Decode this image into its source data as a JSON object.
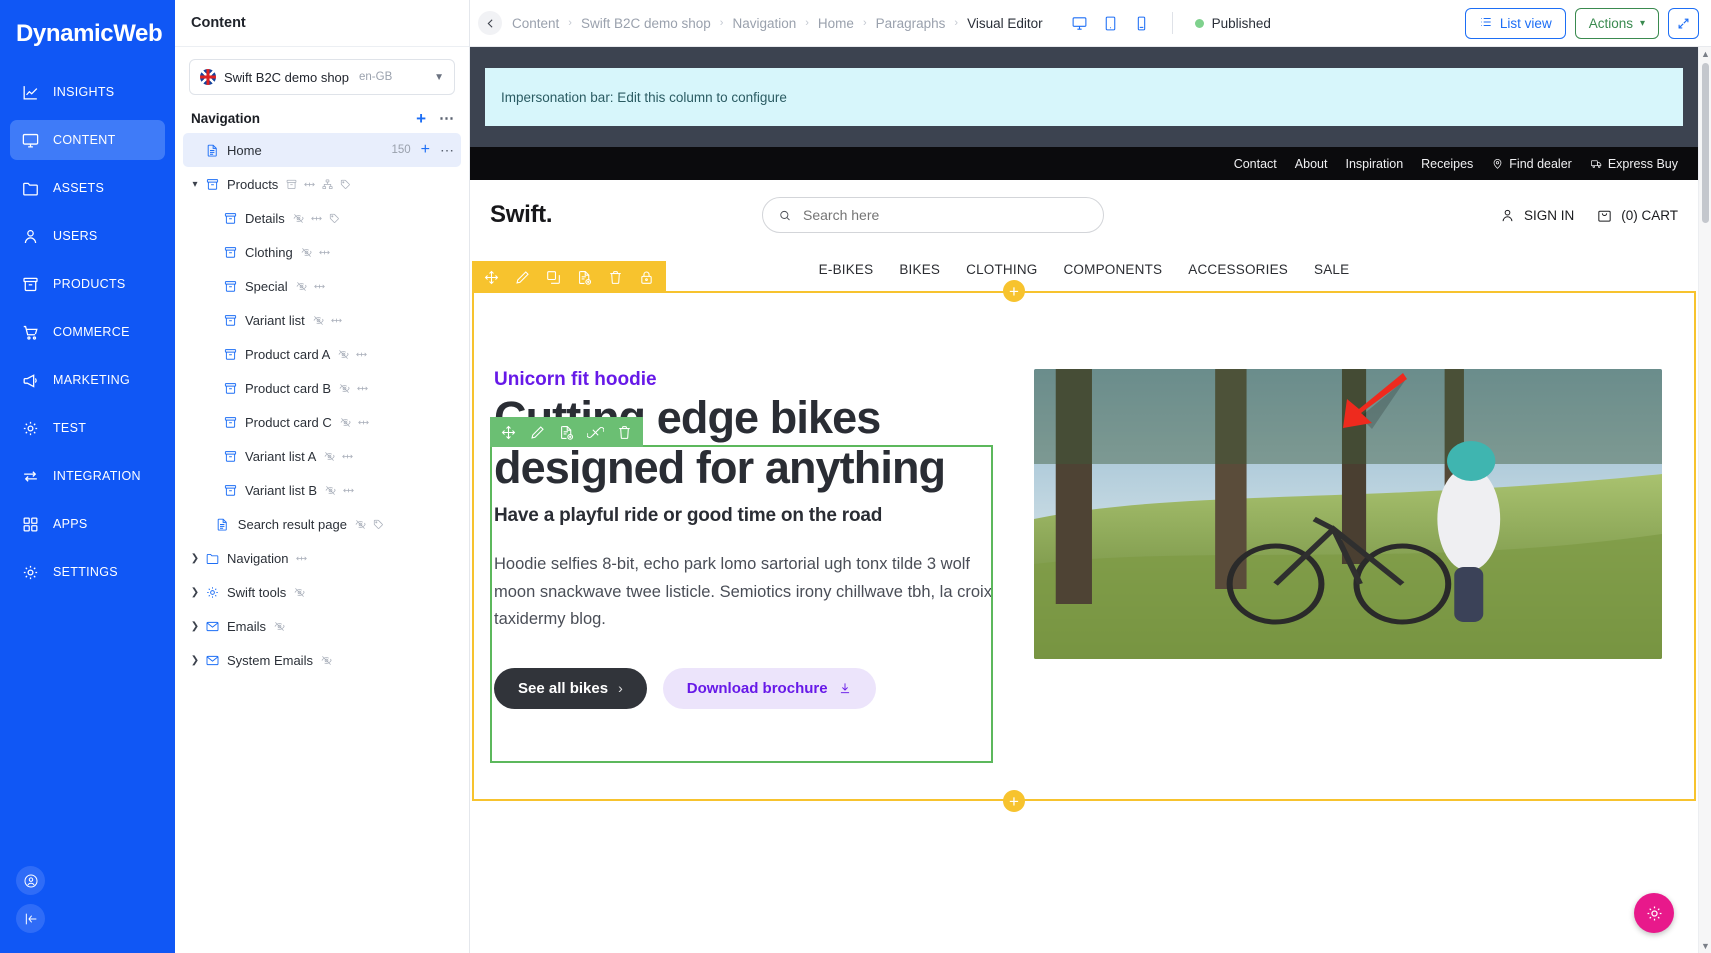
{
  "app": {
    "brand": "DynamicWeb",
    "nav": [
      {
        "label": "INSIGHTS",
        "icon": "chart-icon",
        "active": false
      },
      {
        "label": "CONTENT",
        "icon": "monitor-icon",
        "active": true
      },
      {
        "label": "ASSETS",
        "icon": "folder-icon",
        "active": false
      },
      {
        "label": "USERS",
        "icon": "user-icon",
        "active": false
      },
      {
        "label": "PRODUCTS",
        "icon": "box-icon",
        "active": false
      },
      {
        "label": "COMMERCE",
        "icon": "cart-icon",
        "active": false
      },
      {
        "label": "MARKETING",
        "icon": "megaphone-icon",
        "active": false
      },
      {
        "label": "TEST",
        "icon": "gear-icon",
        "active": false
      },
      {
        "label": "INTEGRATION",
        "icon": "exchange-icon",
        "active": false
      },
      {
        "label": "APPS",
        "icon": "grid-icon",
        "active": false
      },
      {
        "label": "SETTINGS",
        "icon": "gear-icon",
        "active": false
      }
    ],
    "bottom_buttons": [
      {
        "name": "account-button",
        "icon": "user-circle-icon"
      },
      {
        "name": "collapse-sidebar-button",
        "icon": "collapse-left-icon"
      }
    ]
  },
  "tree_panel": {
    "title": "Content",
    "site_selector": {
      "name": "Swift B2C demo shop",
      "language": "en-GB",
      "flag": "uk-flag-icon"
    },
    "section": {
      "title": "Navigation",
      "add_label": "+",
      "more_label": "⋯"
    },
    "items": [
      {
        "label": "Home",
        "icon": "page-icon",
        "depth": 1,
        "twist": "",
        "selected": true,
        "count": "150",
        "badges": [],
        "row_plus": "+",
        "row_dots": "⋯"
      },
      {
        "label": "Products",
        "icon": "box-icon",
        "depth": 1,
        "twist": "v",
        "selected": false,
        "badges": [
          "box-icon",
          "arrows-icon",
          "sitemap-icon",
          "tag-icon"
        ]
      },
      {
        "label": "Details",
        "icon": "box-icon",
        "depth": 2,
        "twist": "",
        "selected": false,
        "badges": [
          "eye-off-icon",
          "arrows-icon",
          "tag-icon"
        ]
      },
      {
        "label": "Clothing",
        "icon": "box-icon",
        "depth": 2,
        "twist": "",
        "selected": false,
        "badges": [
          "eye-off-icon",
          "arrows-icon"
        ]
      },
      {
        "label": "Special",
        "icon": "box-icon",
        "depth": 2,
        "twist": "",
        "selected": false,
        "badges": [
          "eye-off-icon",
          "arrows-icon"
        ]
      },
      {
        "label": "Variant list",
        "icon": "box-icon",
        "depth": 2,
        "twist": "",
        "selected": false,
        "badges": [
          "eye-off-icon",
          "arrows-icon"
        ]
      },
      {
        "label": "Product card A",
        "icon": "box-icon",
        "depth": 2,
        "twist": "",
        "selected": false,
        "badges": [
          "eye-off-icon",
          "arrows-icon"
        ]
      },
      {
        "label": "Product card B",
        "icon": "box-icon",
        "depth": 2,
        "twist": "",
        "selected": false,
        "badges": [
          "eye-off-icon",
          "arrows-icon"
        ]
      },
      {
        "label": "Product card C",
        "icon": "box-icon",
        "depth": 2,
        "twist": "",
        "selected": false,
        "badges": [
          "eye-off-icon",
          "arrows-icon"
        ]
      },
      {
        "label": "Variant list A",
        "icon": "box-icon",
        "depth": 2,
        "twist": "",
        "selected": false,
        "badges": [
          "eye-off-icon",
          "arrows-icon"
        ]
      },
      {
        "label": "Variant list B",
        "icon": "box-icon",
        "depth": 2,
        "twist": "",
        "selected": false,
        "badges": [
          "eye-off-icon",
          "arrows-icon"
        ]
      },
      {
        "label": "Search result page",
        "icon": "page-icon",
        "depth": 1.6,
        "twist": "",
        "selected": false,
        "badges": [
          "eye-off-icon",
          "tag-icon"
        ]
      },
      {
        "label": "Navigation",
        "icon": "folder-icon",
        "depth": 1,
        "twist": ">",
        "selected": false,
        "badges": [
          "arrows-icon"
        ]
      },
      {
        "label": "Swift tools",
        "icon": "gear-icon",
        "depth": 1,
        "twist": ">",
        "selected": false,
        "badges": [
          "eye-off-icon"
        ]
      },
      {
        "label": "Emails",
        "icon": "mail-icon",
        "depth": 1,
        "twist": ">",
        "selected": false,
        "badges": [
          "eye-off-icon"
        ]
      },
      {
        "label": "System Emails",
        "icon": "mail-icon",
        "depth": 1,
        "twist": ">",
        "selected": false,
        "badges": [
          "eye-off-icon"
        ]
      }
    ]
  },
  "topbar": {
    "back_icon": "back-arrow-icon",
    "breadcrumbs": [
      "Content",
      "Swift B2C demo shop",
      "Navigation",
      "Home",
      "Paragraphs",
      "Visual Editor"
    ],
    "separator": "›",
    "devices": [
      {
        "name": "desktop-view-button",
        "icon": "monitor-icon"
      },
      {
        "name": "tablet-view-button",
        "icon": "tablet-icon"
      },
      {
        "name": "mobile-view-button",
        "icon": "mobile-icon"
      }
    ],
    "status": "Published",
    "status_color": "#7fd18d",
    "list_view_label": "List view",
    "actions_label": "Actions",
    "actions_caret": "▾",
    "expand_icon": "expand-icon"
  },
  "preview": {
    "impersonation_text": "Impersonation bar: Edit this column to configure",
    "util_nav": [
      {
        "label": "Contact",
        "icon": null
      },
      {
        "label": "About",
        "icon": null
      },
      {
        "label": "Inspiration",
        "icon": null
      },
      {
        "label": "Receipes",
        "icon": null
      },
      {
        "label": "Find dealer",
        "icon": "location-pin-icon"
      },
      {
        "label": "Express Buy",
        "icon": "truck-icon"
      }
    ],
    "logo": "Swift.",
    "search_placeholder": "Search here",
    "search_value": "",
    "sign_in_label": "SIGN IN",
    "cart_label": "(0) CART",
    "main_nav": [
      "E-BIKES",
      "BIKES",
      "CLOTHING",
      "COMPONENTS",
      "ACCESSORIES",
      "SALE"
    ],
    "hero": {
      "eyebrow": "Unicorn fit hoodie",
      "heading": "Cutting edge bikes designed for anything",
      "subheading": "Have a playful ride or good time on the road",
      "body": "Hoodie selfies 8-bit, echo park lomo sartorial ugh tonx tilde 3 wolf moon snackwave twee listicle. Semiotics irony chillwave tbh, la croix taxidermy blog.",
      "primary_button": "See all bikes",
      "primary_button_chevron": "›",
      "secondary_button": "Download brochure",
      "secondary_button_icon": "download-icon",
      "image_alt": "cyclist-with-bike-on-forest-trail"
    }
  },
  "editor_overlays": {
    "row_toolbar": [
      {
        "name": "move-tool",
        "icon": "move-icon"
      },
      {
        "name": "edit-tool",
        "icon": "pencil-icon"
      },
      {
        "name": "copy-tool",
        "icon": "copy-icon"
      },
      {
        "name": "add-content-tool",
        "icon": "file-add-icon"
      },
      {
        "name": "delete-tool",
        "icon": "trash-icon"
      },
      {
        "name": "lock-tool",
        "icon": "lock-icon"
      }
    ],
    "paragraph_toolbar": [
      {
        "name": "move-tool",
        "icon": "move-icon"
      },
      {
        "name": "edit-tool",
        "icon": "pencil-icon"
      },
      {
        "name": "add-content-tool",
        "icon": "file-add-icon"
      },
      {
        "name": "unlink-tool",
        "icon": "unlink-icon"
      },
      {
        "name": "delete-tool",
        "icon": "trash-icon"
      }
    ],
    "add_badge": "+",
    "row_border_color": "#f7c32e",
    "paragraph_border_color": "#5cb85c",
    "annotation_arrow": "red-arrow-annotation"
  },
  "fab": {
    "name": "settings-fab",
    "icon": "gear-icon",
    "color": "#e8198b"
  }
}
